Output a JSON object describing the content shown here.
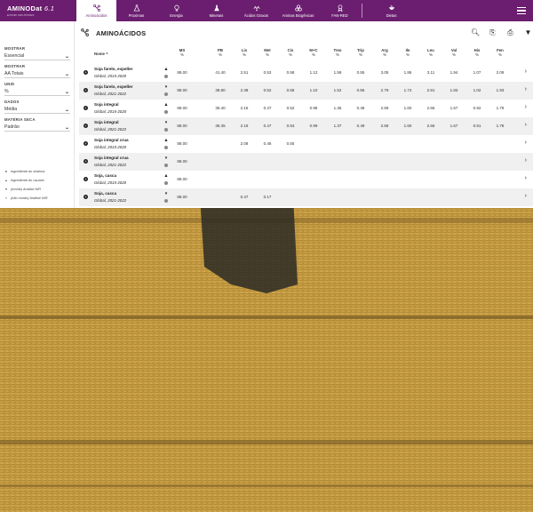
{
  "app": {
    "logo_text": "AMINODat",
    "logo_version": "6.1",
    "logo_sub": "EVONIK INDUSTRIES"
  },
  "nav": {
    "tabs": [
      {
        "label": "Aminoácidos",
        "icon": "molecule-icon"
      },
      {
        "label": "Proximas",
        "icon": "flask-icon"
      },
      {
        "label": "Energia",
        "icon": "bulb-icon"
      },
      {
        "label": "Minerais",
        "icon": "flask-icon"
      },
      {
        "label": "Ácidos Graxos",
        "icon": "fatty-acid-icon"
      },
      {
        "label": "Aminas Biogênicas",
        "icon": "circles-icon"
      },
      {
        "label": "FAN-RED",
        "icon": "ribbon-icon"
      },
      {
        "label": "Dietas",
        "icon": "bowl-icon"
      }
    ],
    "active_tab": "Aminoácidos"
  },
  "sidebar": {
    "filters": [
      {
        "label": "MOSTRAR",
        "value": "Essencial"
      },
      {
        "label": "MOSTRAR",
        "value": "AA Totais"
      },
      {
        "label": "UNID",
        "value": "%"
      },
      {
        "label": "DADOS",
        "value": "Média"
      },
      {
        "label": "MATÉRIA SECA",
        "value": "Padrão"
      }
    ],
    "legend": [
      {
        "icon": "dot-icon",
        "text": "Ingrediente do sistema"
      },
      {
        "icon": "person-icon",
        "text": "Ingrediente do usuário"
      },
      {
        "icon": "funnel-icon",
        "text": "(moído) Análise NIR"
      },
      {
        "icon": "funnel-outline-icon",
        "text": "(não moído) Análise NIR"
      }
    ]
  },
  "main": {
    "title": "AMINOÁCIDOS",
    "tools": [
      "search-icon",
      "export-icon",
      "print-icon",
      "filter-icon"
    ],
    "name_header": "Nome",
    "columns": [
      {
        "name": "MS",
        "unit": "%"
      },
      {
        "name": "PB",
        "unit": "%"
      },
      {
        "name": "Lis",
        "unit": "%"
      },
      {
        "name": "Met",
        "unit": "%"
      },
      {
        "name": "Cis",
        "unit": "%"
      },
      {
        "name": "M+C",
        "unit": "%"
      },
      {
        "name": "Treo",
        "unit": "%"
      },
      {
        "name": "Trip",
        "unit": "%"
      },
      {
        "name": "Arg",
        "unit": "%"
      },
      {
        "name": "Ile",
        "unit": "%"
      },
      {
        "name": "Leu",
        "unit": "%"
      },
      {
        "name": "Val",
        "unit": "%"
      },
      {
        "name": "His",
        "unit": "%"
      },
      {
        "name": "Fen",
        "unit": "%"
      }
    ],
    "rows": [
      {
        "name": "Soja farelo, expeller",
        "sub": "Global, 2015-2020",
        "icon": "drop-icon",
        "values": [
          "88.00",
          "41.40",
          "2.51",
          "0.53",
          "0.58",
          "1.12",
          "1.58",
          "0.55",
          "3.05",
          "1.86",
          "3.11",
          "1.94",
          "1.07",
          "2.09"
        ]
      },
      {
        "name": "Soja farelo, expeller",
        "sub": "Global, 2021-2022",
        "icon": "funnel-icon",
        "values": [
          "88.00",
          "38.80",
          "2.38",
          "0.52",
          "0.58",
          "1.10",
          "1.52",
          "0.55",
          "2.79",
          "1.74",
          "2.91",
          "1.83",
          "1.02",
          "1.93"
        ]
      },
      {
        "name": "Soja integral",
        "sub": "Global, 2015-2020",
        "icon": "drop-icon",
        "values": [
          "88.00",
          "35.40",
          "2.16",
          "0.47",
          "0.52",
          "0.98",
          "1.36",
          "0.48",
          "2.59",
          "1.60",
          "2.66",
          "1.67",
          "0.92",
          "1.79"
        ]
      },
      {
        "name": "Soja integral",
        "sub": "Global, 2021-2022",
        "icon": "funnel-icon",
        "values": [
          "88.00",
          "35.35",
          "2.19",
          "0.47",
          "0.53",
          "0.99",
          "1.37",
          "0.49",
          "2.58",
          "1.60",
          "2.66",
          "1.67",
          "0.91",
          "1.78"
        ]
      },
      {
        "name": "Soja integral crua",
        "sub": "Global, 2015-2020",
        "icon": "drop-icon",
        "values": [
          "88.00",
          "",
          "2.08",
          "0.46",
          "0.55",
          "",
          "",
          "",
          "",
          "",
          "",
          "",
          "",
          ""
        ]
      },
      {
        "name": "Soja integral crua",
        "sub": "Global, 2021-2022",
        "icon": "funnel-icon",
        "values": [
          "88.00",
          "",
          "",
          "",
          "",
          "",
          "",
          "",
          "",
          "",
          "",
          "",
          "",
          ""
        ]
      },
      {
        "name": "Soja, casca",
        "sub": "Global, 2015-2020",
        "icon": "drop-icon",
        "values": [
          "88.00",
          "",
          "",
          "",
          "",
          "",
          "",
          "",
          "",
          "",
          "",
          "",
          "",
          ""
        ]
      },
      {
        "name": "Soja, casca",
        "sub": "Global, 2021-2022",
        "icon": "funnel-icon",
        "values": [
          "88.00",
          "",
          "0.47",
          "0.17",
          "",
          "",
          "",
          "",
          "",
          "",
          "",
          "",
          "",
          ""
        ]
      }
    ]
  },
  "colors": {
    "brand": "#6b1e6f",
    "harvester_body": "#8cbf2a",
    "wheat": "#c9a24a"
  }
}
